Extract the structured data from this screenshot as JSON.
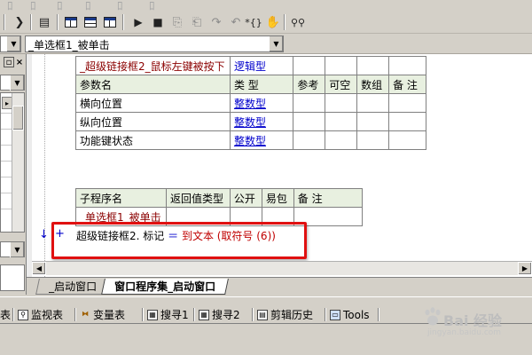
{
  "toolbar": {
    "buttons": [
      "cut-icon",
      "copy-icon",
      "paste-icon",
      "find-icon",
      "window-icon",
      "split-h-icon",
      "split-v-icon",
      "run-icon",
      "stop-icon",
      "step-into-icon",
      "step-over-icon",
      "step-out-icon",
      "run-to-icon",
      "hand-icon",
      "binoculars-icon"
    ]
  },
  "selector": {
    "current": "_单选框1_被单击"
  },
  "event_table": {
    "header": [
      "_超级链接框2_鼠标左键被按下",
      "逻辑型",
      "",
      "",
      "",
      ""
    ],
    "columns": [
      "参数名",
      "类 型",
      "参考",
      "可空",
      "数组",
      "备 注"
    ],
    "rows": [
      {
        "name": "横向位置",
        "type": "整数型"
      },
      {
        "name": "纵向位置",
        "type": "整数型"
      },
      {
        "name": "功能键状态",
        "type": "整数型"
      }
    ]
  },
  "sub_table": {
    "columns": [
      "子程序名",
      "返回值类型",
      "公开",
      "易包",
      "备 注"
    ],
    "rows": [
      {
        "name": "_单选框1_被单击"
      }
    ]
  },
  "code": {
    "marker": "+",
    "arrow": "↓",
    "target": "超级链接框2. 标记",
    "op": "＝",
    "func": "到文本 (取符号 (6))"
  },
  "tabs": [
    {
      "label": "_启动窗口",
      "active": false
    },
    {
      "label": "窗口程序集_启动窗口",
      "active": true
    }
  ],
  "bottom_tabs": [
    {
      "label": "表",
      "icon": "table-icon"
    },
    {
      "label": "监视表",
      "icon": "magnifier-icon"
    },
    {
      "label": "变量表",
      "icon": "variable-icon"
    },
    {
      "label": "搜寻1",
      "icon": "search1-icon"
    },
    {
      "label": "搜寻2",
      "icon": "search2-icon"
    },
    {
      "label": "剪辑历史",
      "icon": "clipboard-icon"
    },
    {
      "label": "Tools",
      "icon": "tools-icon"
    }
  ],
  "watermark": {
    "brand": "Bai 经验",
    "url": "jingyan.baidu.com"
  },
  "colors": {
    "highlight_box": "#e01010",
    "header_bg": "#e8f0e0",
    "type_blue": "#0000cc"
  }
}
